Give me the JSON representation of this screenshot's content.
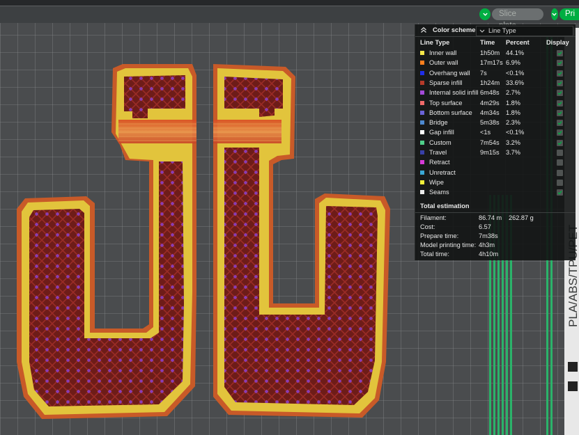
{
  "toolbar": {
    "slice_label": "Slice plate",
    "print_label": "Pri"
  },
  "bed": {
    "side_text": "PLA/ABS/TPU/PET"
  },
  "legend": {
    "color_scheme_label": "Color scheme",
    "scheme_value": "Line Type",
    "columns": {
      "type": "Line Type",
      "time": "Time",
      "percent": "Percent",
      "display": "Display"
    },
    "rows": [
      {
        "name": "Inner wall",
        "time": "1h50m",
        "percent": "44.1%",
        "color": "#f5e74a",
        "displayed": true
      },
      {
        "name": "Outer wall",
        "time": "17m17s",
        "percent": "6.9%",
        "color": "#ff7f1e",
        "displayed": true
      },
      {
        "name": "Overhang wall",
        "time": "7s",
        "percent": "<0.1%",
        "color": "#1f2ee8",
        "displayed": true
      },
      {
        "name": "Sparse infill",
        "time": "1h24m",
        "percent": "33.6%",
        "color": "#b53a2a",
        "displayed": true
      },
      {
        "name": "Internal solid infill",
        "time": "6m48s",
        "percent": "2.7%",
        "color": "#a34ad8",
        "displayed": true
      },
      {
        "name": "Top surface",
        "time": "4m29s",
        "percent": "1.8%",
        "color": "#f06a6a",
        "displayed": true
      },
      {
        "name": "Bottom surface",
        "time": "4m34s",
        "percent": "1.8%",
        "color": "#6a63d8",
        "displayed": true
      },
      {
        "name": "Bridge",
        "time": "5m38s",
        "percent": "2.3%",
        "color": "#4d8ad0",
        "displayed": true
      },
      {
        "name": "Gap infill",
        "time": "<1s",
        "percent": "<0.1%",
        "color": "#ffffff",
        "displayed": true
      },
      {
        "name": "Custom",
        "time": "7m54s",
        "percent": "3.2%",
        "color": "#4fd08a",
        "displayed": true
      },
      {
        "name": "Travel",
        "time": "9m15s",
        "percent": "3.7%",
        "color": "#3840a8",
        "displayed": false
      },
      {
        "name": "Retract",
        "time": "",
        "percent": "",
        "color": "#d63ad6",
        "displayed": false
      },
      {
        "name": "Unretract",
        "time": "",
        "percent": "",
        "color": "#3aa8d6",
        "displayed": false
      },
      {
        "name": "Wipe",
        "time": "",
        "percent": "",
        "color": "#f0f03a",
        "displayed": false
      },
      {
        "name": "Seams",
        "time": "",
        "percent": "",
        "color": "#ececec",
        "displayed": true
      }
    ],
    "total": {
      "title": "Total estimation",
      "filament_label": "Filament:",
      "filament_length": "86.74 m",
      "filament_weight": "262.87 g",
      "cost_label": "Cost:",
      "cost": "6.57",
      "prepare_label": "Prepare time:",
      "prepare": "7m38s",
      "model_label": "Model printing time:",
      "model": "4h3m",
      "total_label": "Total time:",
      "total": "4h10m"
    }
  },
  "colors": {
    "accent": "#00ae42",
    "inner_wall": "#e2c43c",
    "outer_wall": "#c85a28",
    "sparse_infill": "#6e1c18",
    "internal_solid": "#8a3cb4",
    "bed_grid": "#8f9393",
    "bed": "#4a4c4e"
  }
}
